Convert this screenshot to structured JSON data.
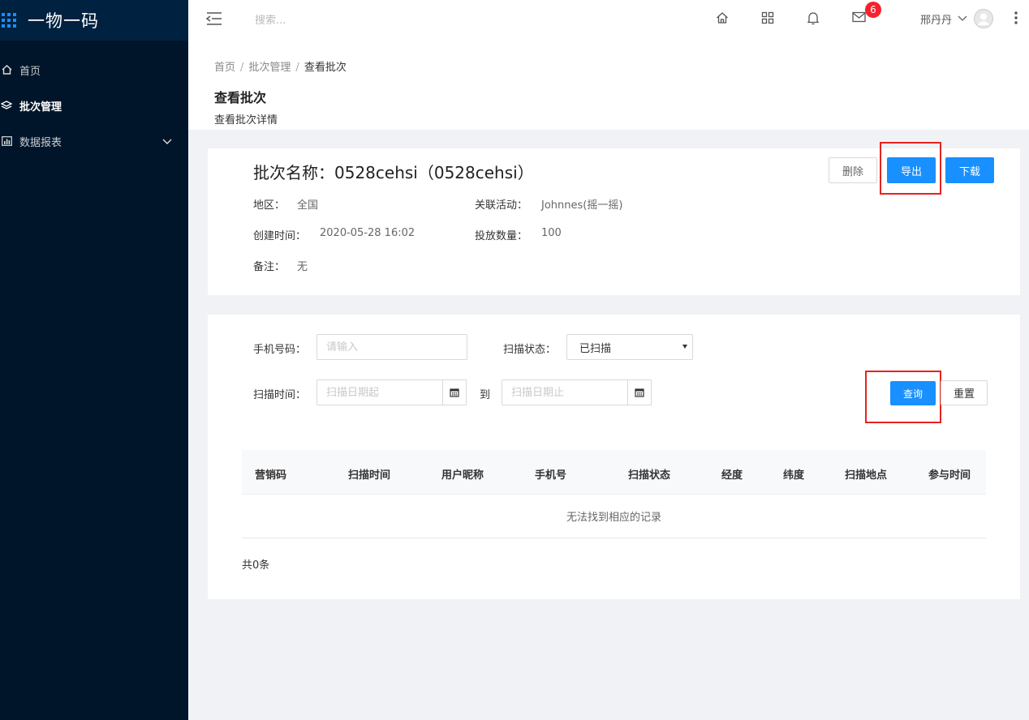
{
  "app": {
    "title": "一物一码"
  },
  "sidebar": {
    "items": [
      {
        "label": "首页",
        "icon": "home-icon",
        "active": false
      },
      {
        "label": "批次管理",
        "icon": "layers-icon",
        "active": true
      },
      {
        "label": "数据报表",
        "icon": "chart-icon",
        "active": false,
        "expandable": true
      }
    ]
  },
  "header": {
    "search_placeholder": "搜索...",
    "mail_badge": "6",
    "username": "邢丹丹"
  },
  "breadcrumb": {
    "items": [
      "首页",
      "批次管理",
      "查看批次"
    ]
  },
  "page": {
    "title": "查看批次",
    "description": "查看批次详情"
  },
  "batch": {
    "name": "批次名称：0528cehsi（0528cehsi）",
    "region_label": "地区：",
    "region_value": "全国",
    "activity_label": "关联活动：",
    "activity_value": "Johnnes(摇一摇)",
    "created_label": "创建时间：",
    "created_value": "2020-05-28 16:02",
    "quantity_label": "投放数量：",
    "quantity_value": "100",
    "remark_label": "备注：",
    "remark_value": "无"
  },
  "actions": {
    "delete": "删除",
    "export": "导出",
    "download": "下载"
  },
  "filters": {
    "phone_label": "手机号码：",
    "phone_placeholder": "请输入",
    "status_label": "扫描状态：",
    "status_value": "已扫描",
    "time_label": "扫描时间：",
    "start_placeholder": "扫描日期起",
    "to_label": "到",
    "end_placeholder": "扫描日期止",
    "query": "查询",
    "reset": "重置"
  },
  "table": {
    "columns": [
      "营销码",
      "扫描时间",
      "用户昵称",
      "手机号",
      "扫描状态",
      "经度",
      "纬度",
      "扫描地点",
      "参与时间"
    ],
    "empty_text": "无法找到相应的记录",
    "total": "共0条"
  },
  "colors": {
    "sidebar_bg": "#001529",
    "primary": "#1890ff",
    "highlight_box": "#e6231f",
    "badge": "#f5222d"
  }
}
